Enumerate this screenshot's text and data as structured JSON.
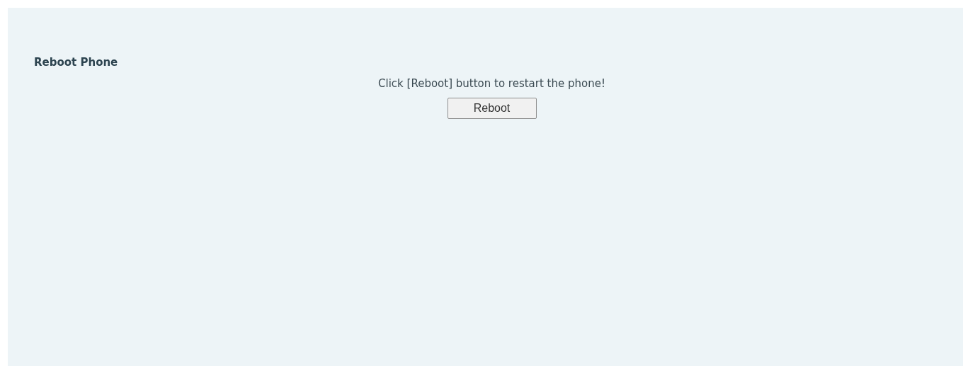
{
  "section": {
    "title": "Reboot Phone"
  },
  "instruction": "Click [Reboot] button to restart the phone!",
  "reboot_button": {
    "label": "Reboot"
  }
}
